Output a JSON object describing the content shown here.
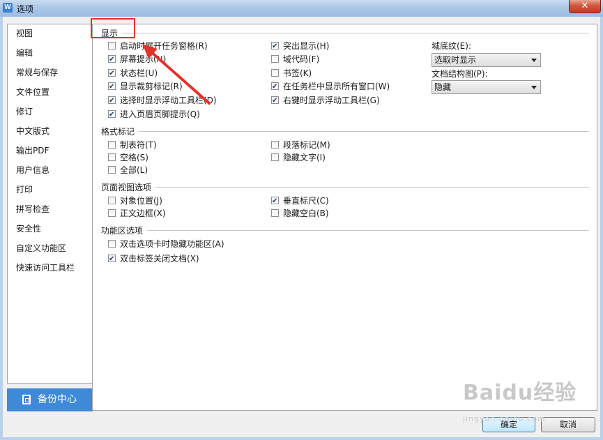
{
  "window": {
    "title": "选项",
    "app_icon": "W",
    "close_label": "✕"
  },
  "nav": {
    "items": [
      {
        "label": "视图",
        "active": true
      },
      {
        "label": "编辑"
      },
      {
        "label": "常规与保存"
      },
      {
        "label": "文件位置"
      },
      {
        "label": "修订"
      },
      {
        "label": "中文版式"
      },
      {
        "label": "输出PDF"
      },
      {
        "label": "用户信息"
      },
      {
        "label": "打印"
      },
      {
        "label": "拼写检查"
      },
      {
        "label": "安全性"
      },
      {
        "label": "自定义功能区"
      },
      {
        "label": "快速访问工具栏"
      }
    ],
    "backup_label": "备份中心"
  },
  "display": {
    "title": "显示",
    "col1": [
      {
        "label": "启动时展开任务窗格(R)",
        "checked": false
      },
      {
        "label": "屏幕提示(N)",
        "checked": true
      },
      {
        "label": "状态栏(U)",
        "checked": true
      },
      {
        "label": "显示裁剪标记(R)",
        "checked": true
      },
      {
        "label": "选择时显示浮动工具栏(D)",
        "checked": true
      },
      {
        "label": "进入页眉页脚提示(Q)",
        "checked": true
      }
    ],
    "col2": [
      {
        "label": "突出显示(H)",
        "checked": true
      },
      {
        "label": "域代码(F)",
        "checked": false
      },
      {
        "label": "书签(K)",
        "checked": false
      },
      {
        "label": "在任务栏中显示所有窗口(W)",
        "checked": true
      },
      {
        "label": "右键时显示浮动工具栏(G)",
        "checked": true
      }
    ],
    "field_shading_label": "域底纹(E):",
    "field_shading_value": "选取时显示",
    "doc_map_label": "文档结构图(P):",
    "doc_map_value": "隐藏"
  },
  "format_marks": {
    "title": "格式标记",
    "col1": [
      {
        "label": "制表符(T)",
        "checked": false
      },
      {
        "label": "空格(S)",
        "checked": false
      },
      {
        "label": "全部(L)",
        "checked": false
      }
    ],
    "col2": [
      {
        "label": "段落标记(M)",
        "checked": false
      },
      {
        "label": "隐藏文字(I)",
        "checked": false
      }
    ]
  },
  "page_view": {
    "title": "页面视图选项",
    "col1": [
      {
        "label": "对象位置(J)",
        "checked": false
      },
      {
        "label": "正文边框(X)",
        "checked": false
      }
    ],
    "col2": [
      {
        "label": "垂直标尺(C)",
        "checked": true
      },
      {
        "label": "隐藏空白(B)",
        "checked": false
      }
    ]
  },
  "ribbon": {
    "title": "功能区选项",
    "items": [
      {
        "label": "双击选项卡时隐藏功能区(A)",
        "checked": false
      },
      {
        "label": "双击标签关闭文档(X)",
        "checked": true
      }
    ]
  },
  "footer": {
    "ok_label": "确定",
    "cancel_label": "取消"
  },
  "watermark": {
    "brand": "Baidu经验",
    "url": "jingyan.baidu.com"
  },
  "colors": {
    "accent": "#3e8ad9",
    "highlight": "#e3322b",
    "close": "#c23c22"
  }
}
